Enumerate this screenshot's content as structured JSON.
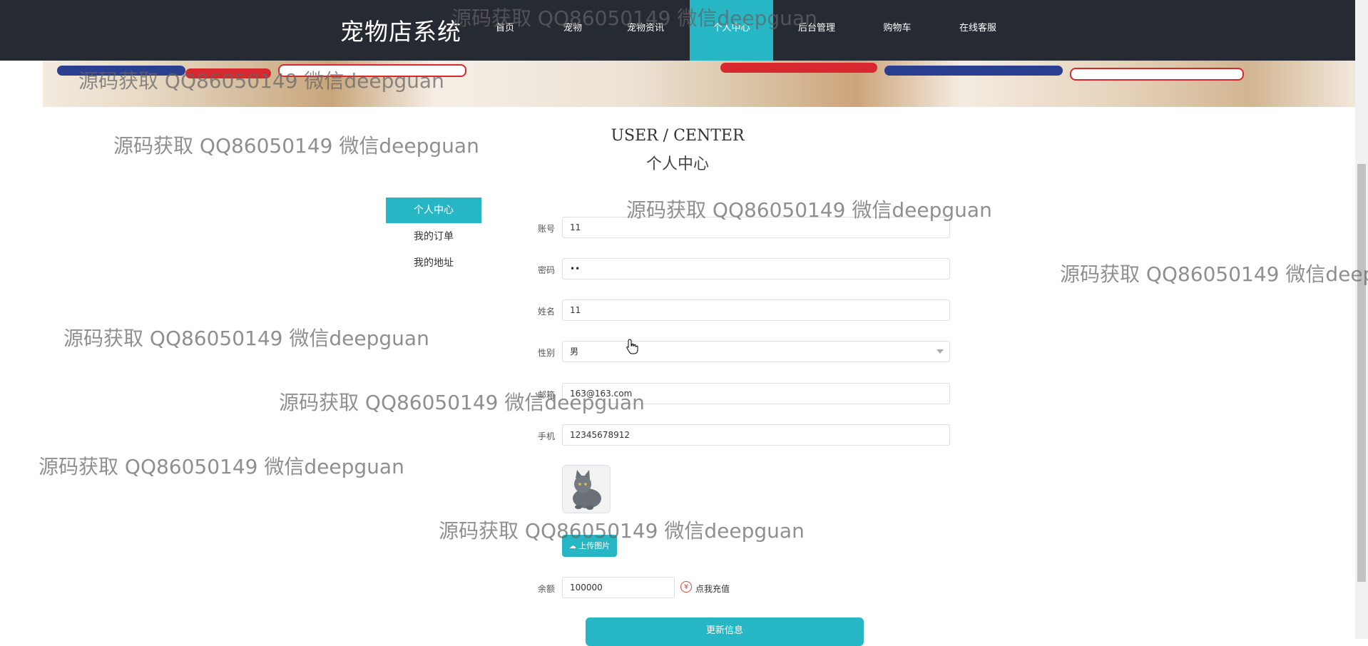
{
  "header": {
    "brand": "宠物店系统",
    "nav": [
      "首页",
      "宠物",
      "宠物资讯",
      "个人中心",
      "后台管理",
      "购物车",
      "在线客服"
    ],
    "active_nav": "个人中心"
  },
  "page_heading": {
    "en": "USER / CENTER",
    "cn": "个人中心"
  },
  "sidebar": {
    "items": [
      "个人中心",
      "我的订单",
      "我的地址"
    ],
    "active": "个人中心"
  },
  "form": {
    "account": {
      "label": "账号",
      "value": "11"
    },
    "password": {
      "label": "密码",
      "value": "••"
    },
    "name": {
      "label": "姓名",
      "value": "11"
    },
    "gender": {
      "label": "性别",
      "value": "男"
    },
    "email": {
      "label": "邮箱",
      "value": "163@163.com"
    },
    "phone": {
      "label": "手机",
      "value": "12345678912"
    },
    "upload_label": "上传图片",
    "balance": {
      "label": "余额",
      "value": "100000"
    },
    "recharge_label": "点我充值",
    "recharge_icon": "¥",
    "submit_label": "更新信息"
  },
  "watermark": "源码获取 QQ86050149 微信deepguan",
  "icons": [
    "cloud-upload-icon",
    "yen-circle-icon",
    "hand-cursor-icon"
  ],
  "colors": {
    "accent": "#26b6c4",
    "nav_bg": "#262a33",
    "warning": "#e0433b"
  }
}
